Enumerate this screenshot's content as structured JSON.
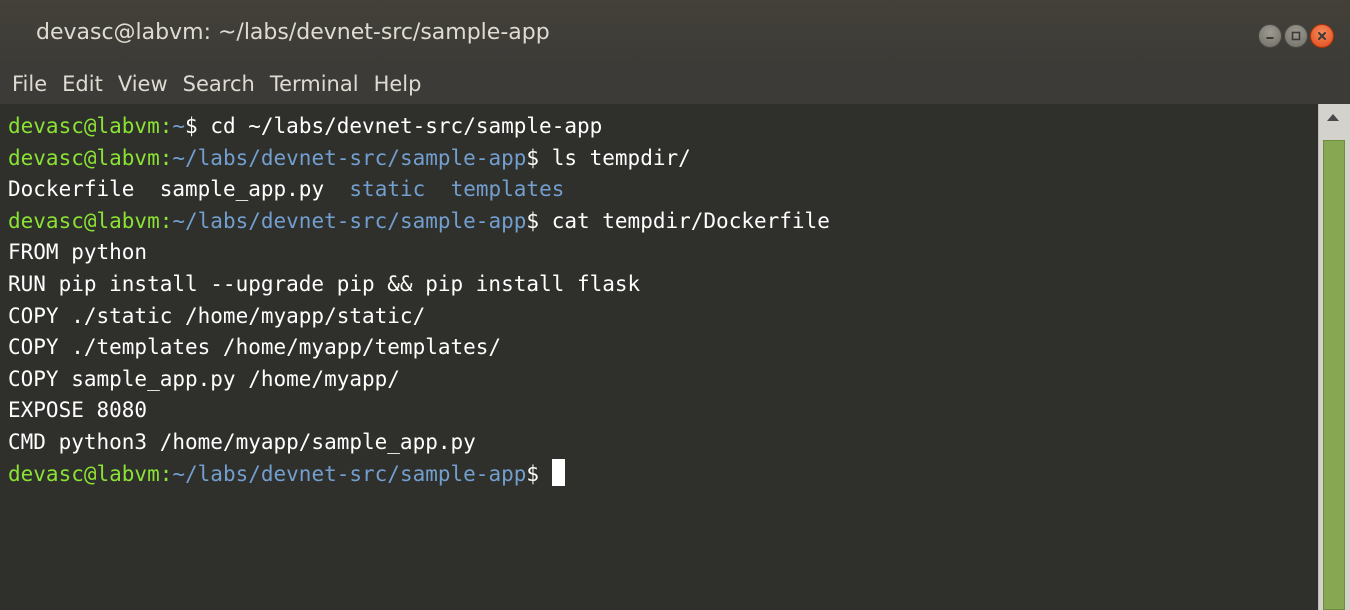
{
  "window": {
    "title": "devasc@labvm: ~/labs/devnet-src/sample-app"
  },
  "menu": {
    "items": [
      "File",
      "Edit",
      "View",
      "Search",
      "Terminal",
      "Help"
    ]
  },
  "terminal": {
    "prompt_user": "devasc@labvm",
    "lines": [
      {
        "path": "~",
        "cmd": "cd ~/labs/devnet-src/sample-app"
      },
      {
        "path": "~/labs/devnet-src/sample-app",
        "cmd": "ls tempdir/"
      },
      {
        "ls_files": [
          "Dockerfile",
          "sample_app.py"
        ],
        "ls_dirs": [
          "static",
          "templates"
        ]
      },
      {
        "path": "~/labs/devnet-src/sample-app",
        "cmd": "cat tempdir/Dockerfile"
      },
      {
        "text": "FROM python"
      },
      {
        "text": "RUN pip install --upgrade pip && pip install flask"
      },
      {
        "text": "COPY ./static /home/myapp/static/"
      },
      {
        "text": "COPY ./templates /home/myapp/templates/"
      },
      {
        "text": "COPY sample_app.py /home/myapp/"
      },
      {
        "text": "EXPOSE 8080"
      },
      {
        "text": "CMD python3 /home/myapp/sample_app.py"
      },
      {
        "path": "~/labs/devnet-src/sample-app",
        "cmd": ""
      }
    ]
  },
  "icons": {
    "minimize": "minimize-icon",
    "maximize": "maximize-icon",
    "close": "close-icon"
  },
  "colors": {
    "background": "#2f2f2b",
    "prompt_user": "#8ae234",
    "prompt_path": "#729fcf",
    "text": "#ffffff",
    "scroll_thumb": "#87a752",
    "close_button": "#df4a16"
  }
}
